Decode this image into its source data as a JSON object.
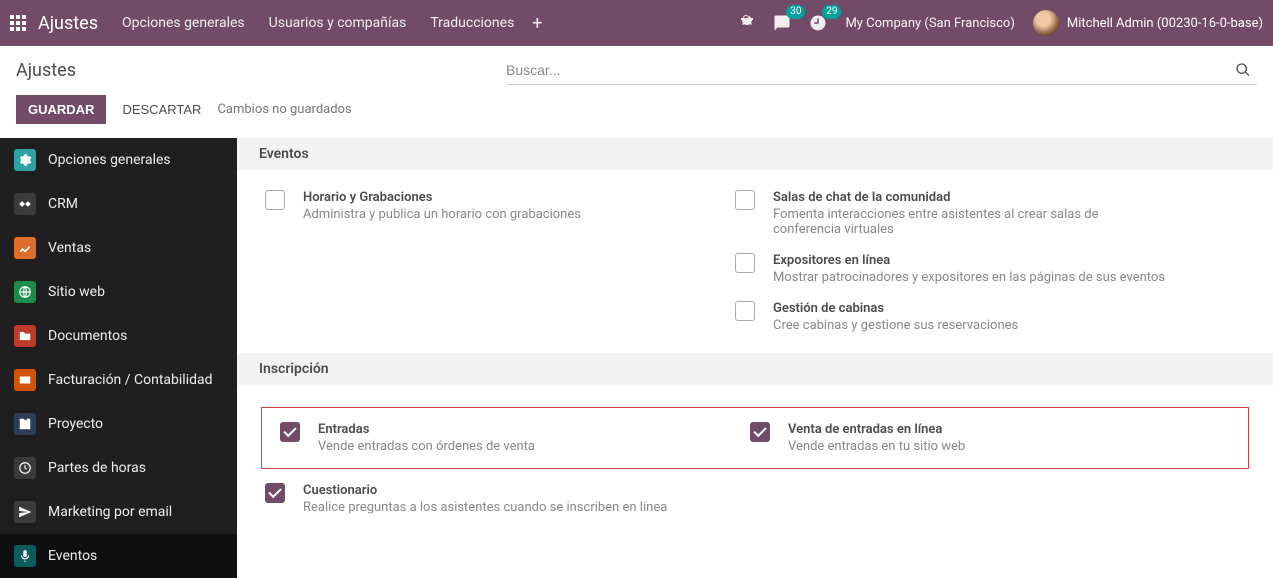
{
  "topbar": {
    "brand": "Ajustes",
    "menu": [
      "Opciones generales",
      "Usuarios y compañías",
      "Traducciones"
    ],
    "messages_badge": "30",
    "activities_badge": "29",
    "company": "My Company (San Francisco)",
    "user": "Mitchell Admin (00230-16-0-base)"
  },
  "subhead": {
    "title": "Ajustes",
    "search_placeholder": "Buscar..."
  },
  "actions": {
    "save": "GUARDAR",
    "discard": "DESCARTAR",
    "dirty": "Cambios no guardados"
  },
  "sidebar": {
    "items": [
      {
        "label": "Opciones generales",
        "color": "#2EA3A6"
      },
      {
        "label": "CRM",
        "color": "#3b3b3b"
      },
      {
        "label": "Ventas",
        "color": "#E06C2B"
      },
      {
        "label": "Sitio web",
        "color": "#1F8B4C"
      },
      {
        "label": "Documentos",
        "color": "#C0392B"
      },
      {
        "label": "Facturación / Contabilidad",
        "color": "#D35400"
      },
      {
        "label": "Proyecto",
        "color": "#2C3E50"
      },
      {
        "label": "Partes de horas",
        "color": "#3b3b3b"
      },
      {
        "label": "Marketing por email",
        "color": "#3b3b3b"
      },
      {
        "label": "Eventos",
        "color": "#0b5c5c"
      }
    ]
  },
  "sections": {
    "events": {
      "title": "Eventos",
      "left": [
        {
          "h": "Horario y Grabaciones",
          "d": "Administra y publica un horario con grabaciones",
          "checked": false
        }
      ],
      "right": [
        {
          "h": "Salas de chat de la comunidad",
          "d": "Fomenta interacciones entre asistentes al crear salas de conferencia virtuales",
          "checked": false
        },
        {
          "h": "Expositores en línea",
          "d": "Mostrar patrocinadores y expositores en las páginas de sus eventos",
          "checked": false
        },
        {
          "h": "Gestión de cabinas",
          "d": "Cree cabinas y gestione sus reservaciones",
          "checked": false
        }
      ]
    },
    "registration": {
      "title": "Inscripción",
      "hl_left": {
        "h": "Entradas",
        "d": "Vende entradas con órdenes de venta",
        "checked": true
      },
      "hl_right": {
        "h": "Venta de entradas en línea",
        "d": "Vende entradas en tu sitio web",
        "checked": true
      },
      "below": {
        "h": "Cuestionario",
        "d": "Realice preguntas a los asistentes cuando se inscriben en línea",
        "checked": true
      }
    }
  }
}
